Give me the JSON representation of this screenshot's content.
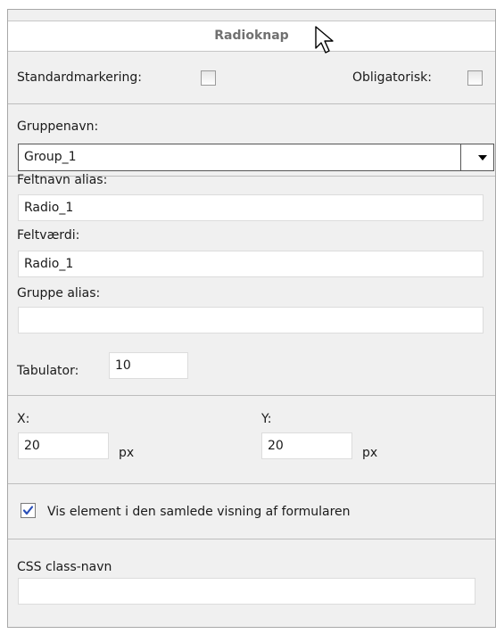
{
  "header": {
    "title": "Radioknap"
  },
  "options": {
    "default_label": "Standardmarkering:",
    "default_checked": false,
    "required_label": "Obligatorisk:",
    "required_checked": false
  },
  "group": {
    "label": "Gruppenavn:",
    "value": "Group_1"
  },
  "fields": {
    "alias_label": "Feltnavn alias:",
    "alias_value": "Radio_1",
    "value_label": "Feltværdi:",
    "value_value": "Radio_1",
    "group_alias_label": "Gruppe alias:",
    "group_alias_value": ""
  },
  "tab": {
    "label": "Tabulator:",
    "value": "10"
  },
  "position": {
    "x_label": "X:",
    "x_value": "20",
    "x_unit": "px",
    "y_label": "Y:",
    "y_value": "20",
    "y_unit": "px"
  },
  "visibility": {
    "label": "Vis element i den samlede visning af formularen",
    "checked": true
  },
  "css": {
    "label": "CSS class-navn",
    "value": ""
  },
  "colors": {
    "panel_bg": "#f0f0f0",
    "check_blue": "#2a4fb8",
    "header_text": "#707070"
  },
  "icons": {
    "cursor": "mouse-pointer-icon",
    "dropdown": "dropdown-arrow-icon",
    "check": "checkmark-icon"
  }
}
